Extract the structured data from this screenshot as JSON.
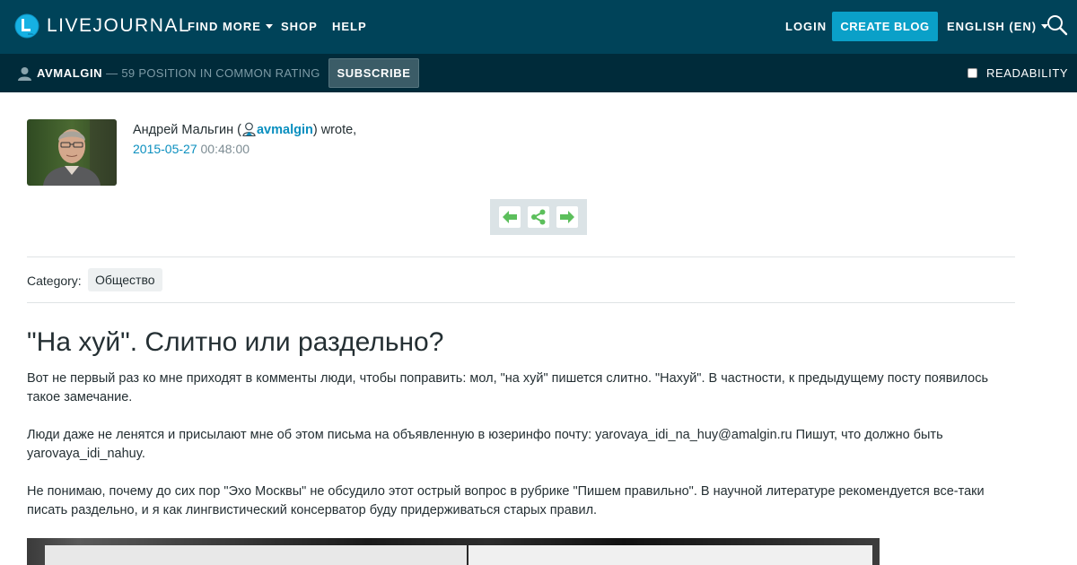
{
  "header": {
    "logo_text": "LIVEJOURNAL",
    "nav": [
      {
        "label": "FIND MORE",
        "has_dropdown": true
      },
      {
        "label": "SHOP",
        "has_dropdown": false
      },
      {
        "label": "HELP",
        "has_dropdown": false
      }
    ],
    "login_label": "LOGIN",
    "create_blog_label": "CREATE BLOG",
    "language_label": "ENGLISH (EN)",
    "search_icon": "search-icon"
  },
  "subheader": {
    "username": "AVMALGIN",
    "rating_text": "— 59 POSITION IN COMMON RATING",
    "subscribe_label": "SUBSCRIBE",
    "readability_label": "READABILITY",
    "readability_checked": false
  },
  "post": {
    "author_name": "Андрей Мальгин (",
    "username": "avmalgin",
    "wrote_text": ") wrote,",
    "date": "2015-05-27",
    "time": "00:48:00",
    "category_label": "Category:",
    "category_tag": "Общество",
    "title": "\"На хуй\". Слитно или раздельно?",
    "paragraphs": [
      "Вот не первый раз ко мне приходят в комменты люди, чтобы поправить: мол, \"на хуй\" пишется слитно. \"Нахуй\". В частности, к предыдущему посту появилось такое замечание.",
      "Люди даже не ленятся и присылают мне об этом письма на объявленную в юзеринфо почту: yarovaya_idi_na_huy@amalgin.ru Пишут, что должно быть yarovaya_idi_nahuy.",
      "Не понимаю, почему до сих пор \"Эхо Москвы\" не обсудило этот острый вопрос в рубрике \"Пишем правильно\". В научной литературе рекомендуется все-таки писать раздельно, и я как лингвистический консерватор буду придерживаться старых правил."
    ]
  },
  "colors": {
    "header_bg": "#004359",
    "subheader_bg": "#002b3a",
    "accent": "#0aa0c8",
    "link": "#0a8fbf",
    "arrow_green": "#5cbf5c"
  }
}
